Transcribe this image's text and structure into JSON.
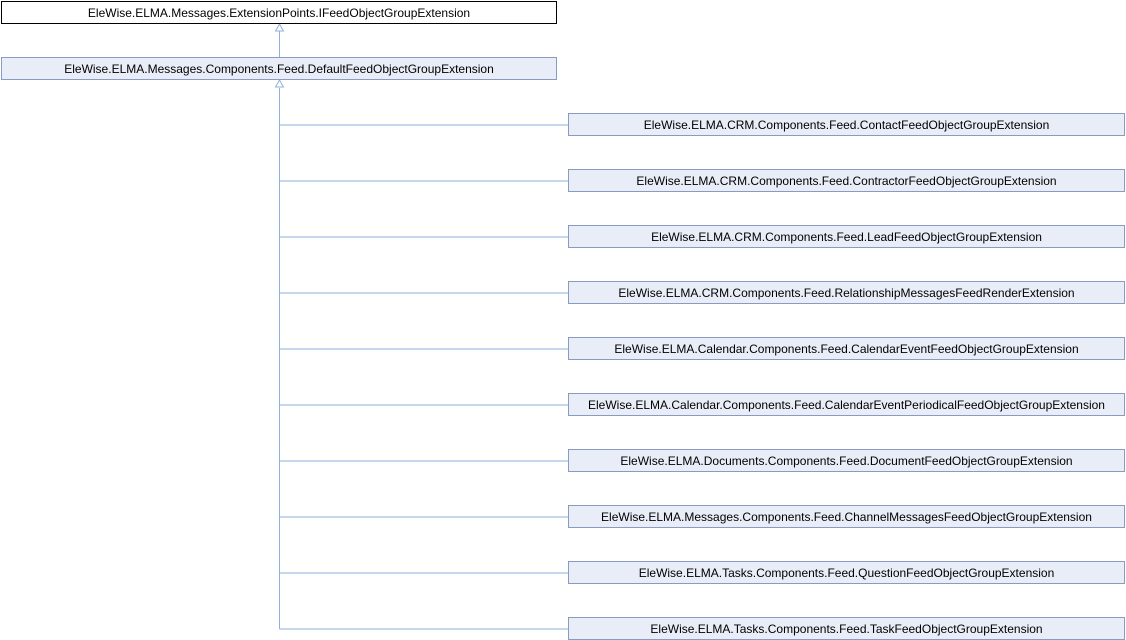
{
  "diagram": {
    "type": "class-inheritance",
    "colors": {
      "edge": "#8fb0d8",
      "interface_fill": "#ffffff",
      "interface_border": "#000000",
      "class_fill": "#e8edf7",
      "class_border": "#8a9bc2"
    },
    "interface": {
      "label": "EleWise.ELMA.Messages.ExtensionPoints.IFeedObjectGroupExtension"
    },
    "base_class": {
      "label": "EleWise.ELMA.Messages.Components.Feed.DefaultFeedObjectGroupExtension"
    },
    "derived": [
      {
        "label": "EleWise.ELMA.CRM.Components.Feed.ContactFeedObjectGroupExtension"
      },
      {
        "label": "EleWise.ELMA.CRM.Components.Feed.ContractorFeedObjectGroupExtension"
      },
      {
        "label": "EleWise.ELMA.CRM.Components.Feed.LeadFeedObjectGroupExtension"
      },
      {
        "label": "EleWise.ELMA.CRM.Components.Feed.RelationshipMessagesFeedRenderExtension"
      },
      {
        "label": "EleWise.ELMA.Calendar.Components.Feed.CalendarEventFeedObjectGroupExtension"
      },
      {
        "label": "EleWise.ELMA.Calendar.Components.Feed.CalendarEventPeriodicalFeedObjectGroupExtension"
      },
      {
        "label": "EleWise.ELMA.Documents.Components.Feed.DocumentFeedObjectGroupExtension"
      },
      {
        "label": "EleWise.ELMA.Messages.Components.Feed.ChannelMessagesFeedObjectGroupExtension"
      },
      {
        "label": "EleWise.ELMA.Tasks.Components.Feed.QuestionFeedObjectGroupExtension"
      },
      {
        "label": "EleWise.ELMA.Tasks.Components.Feed.TaskFeedObjectGroupExtension"
      }
    ]
  }
}
